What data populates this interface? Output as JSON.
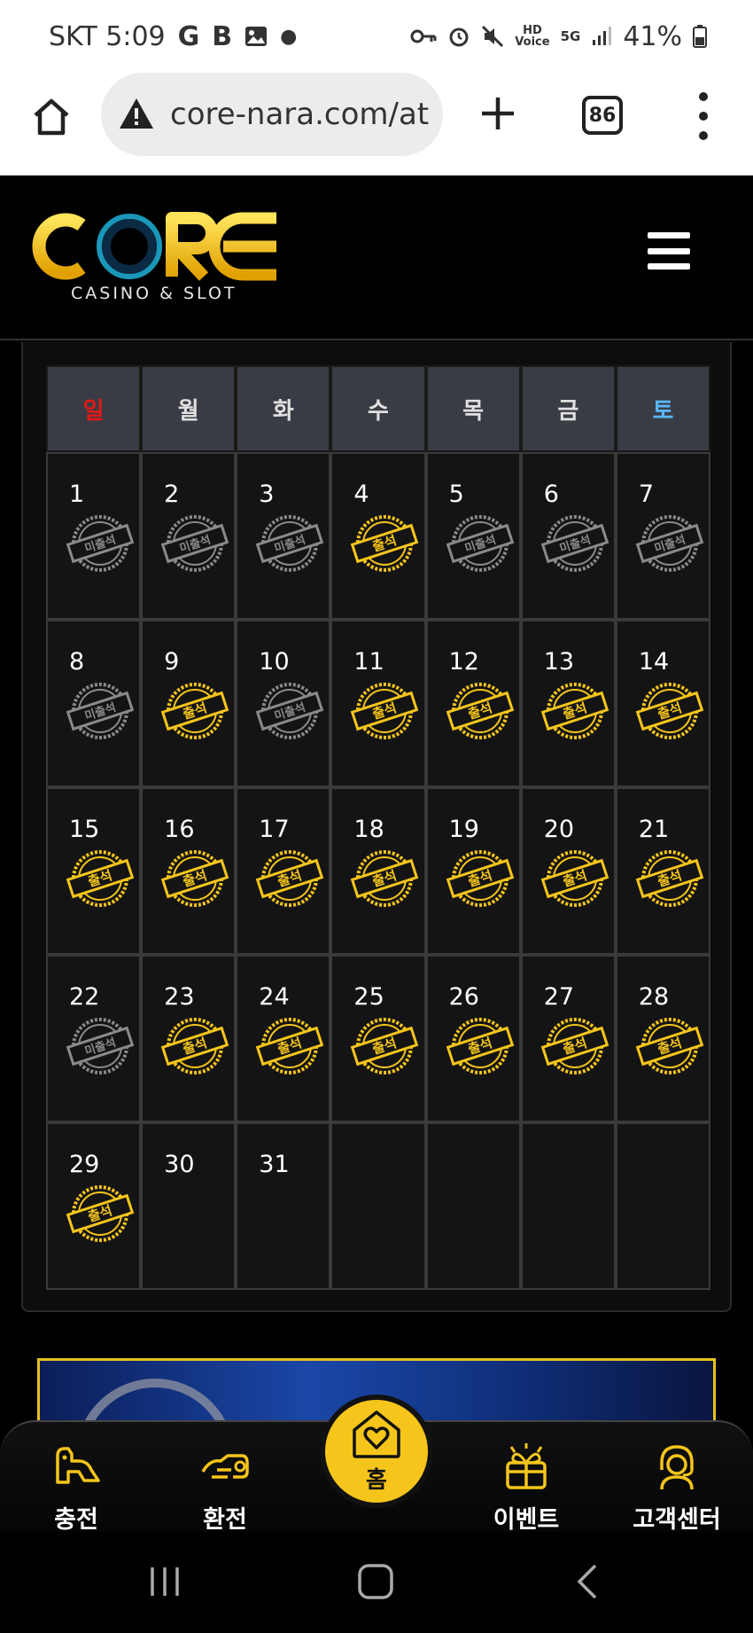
{
  "status_bar": {
    "carrier_time": "SKT 5:09",
    "battery": "41%",
    "icons": [
      "google-icon",
      "b-icon",
      "image-icon",
      "dot-icon",
      "key-icon",
      "alarm-icon",
      "mute-icon",
      "hd-voice-icon",
      "5g-icon",
      "signal-icon",
      "battery-icon"
    ]
  },
  "browser": {
    "url": "core-nara.com/at",
    "tab_count": "86"
  },
  "site": {
    "logo_text": "CORE",
    "logo_subtitle": "CASINO & SLOT"
  },
  "calendar": {
    "weekdays": [
      "일",
      "월",
      "화",
      "수",
      "목",
      "금",
      "토"
    ],
    "weekday_colors": [
      "#e01818",
      "#e0e0e0",
      "#e0e0e0",
      "#e0e0e0",
      "#e0e0e0",
      "#e0e0e0",
      "#5bb8ff"
    ],
    "stamp_labels": {
      "attended": "출석",
      "absent": "미출석"
    },
    "days": [
      {
        "day": "1",
        "status": "absent"
      },
      {
        "day": "2",
        "status": "absent"
      },
      {
        "day": "3",
        "status": "absent"
      },
      {
        "day": "4",
        "status": "attended"
      },
      {
        "day": "5",
        "status": "absent"
      },
      {
        "day": "6",
        "status": "absent"
      },
      {
        "day": "7",
        "status": "absent"
      },
      {
        "day": "8",
        "status": "absent"
      },
      {
        "day": "9",
        "status": "attended"
      },
      {
        "day": "10",
        "status": "absent"
      },
      {
        "day": "11",
        "status": "attended"
      },
      {
        "day": "12",
        "status": "attended"
      },
      {
        "day": "13",
        "status": "attended"
      },
      {
        "day": "14",
        "status": "attended"
      },
      {
        "day": "15",
        "status": "attended"
      },
      {
        "day": "16",
        "status": "attended"
      },
      {
        "day": "17",
        "status": "attended"
      },
      {
        "day": "18",
        "status": "attended"
      },
      {
        "day": "19",
        "status": "attended"
      },
      {
        "day": "20",
        "status": "attended"
      },
      {
        "day": "21",
        "status": "attended"
      },
      {
        "day": "22",
        "status": "absent"
      },
      {
        "day": "23",
        "status": "attended"
      },
      {
        "day": "24",
        "status": "attended"
      },
      {
        "day": "25",
        "status": "attended"
      },
      {
        "day": "26",
        "status": "attended"
      },
      {
        "day": "27",
        "status": "attended"
      },
      {
        "day": "28",
        "status": "attended"
      },
      {
        "day": "29",
        "status": "attended"
      },
      {
        "day": "30",
        "status": "none"
      },
      {
        "day": "31",
        "status": "none"
      },
      {
        "day": "",
        "status": "none"
      },
      {
        "day": "",
        "status": "none"
      },
      {
        "day": "",
        "status": "none"
      },
      {
        "day": "",
        "status": "none"
      }
    ]
  },
  "bottom_nav": {
    "deposit": "충전",
    "withdraw": "환전",
    "home": "홈",
    "event": "이벤트",
    "support": "고객센터"
  },
  "colors": {
    "gold": "#f5c51b",
    "absent_gray": "#8a8a8a"
  }
}
